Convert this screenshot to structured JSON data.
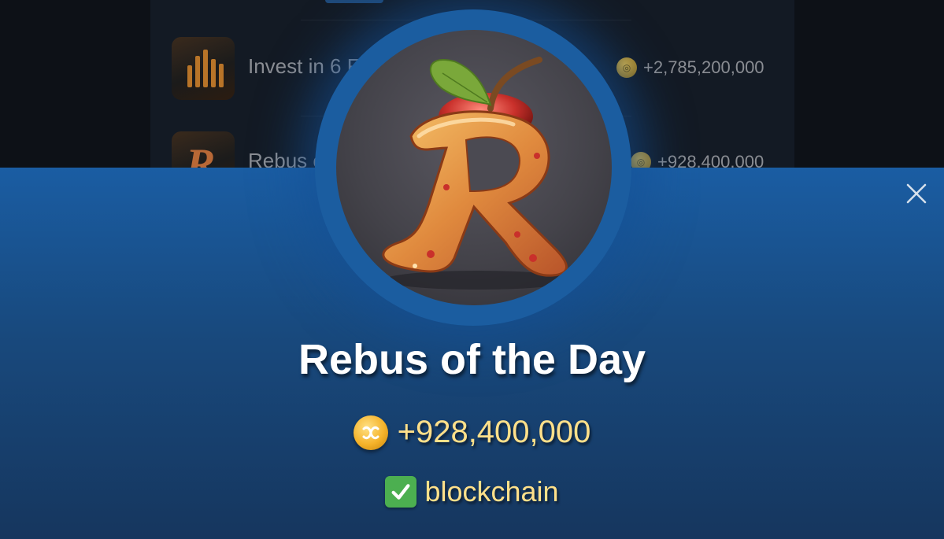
{
  "background_list": {
    "items": [
      {
        "title": "Invest in 6 Fu",
        "reward": "+2,785,200,000",
        "icon": "chart-icon"
      },
      {
        "title": "Rebus of",
        "reward": "+928,400,000",
        "icon": "apple-r-icon"
      }
    ]
  },
  "modal": {
    "close_icon": "close-icon",
    "image_icon": "apple-r-icon",
    "title": "Rebus of the Day",
    "reward_icon": "coin-icon",
    "reward": "+928,400,000",
    "answer_icon": "check-icon",
    "answer": "blockchain",
    "colors": {
      "sheet_top": "#1a5da3",
      "sheet_bottom": "#16365e",
      "reward_text": "#ffe08a",
      "check_green": "#4caf50"
    }
  }
}
